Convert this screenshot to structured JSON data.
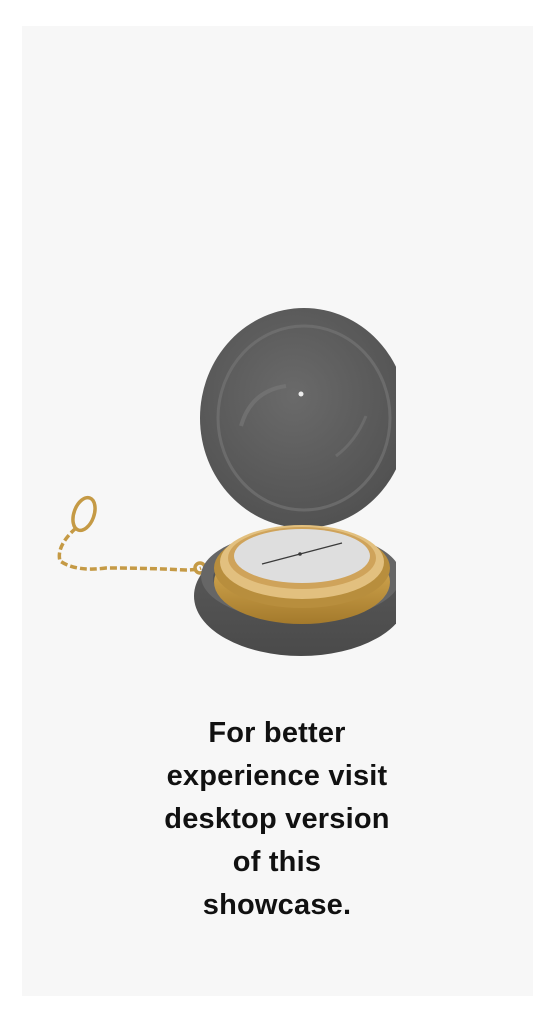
{
  "notice": {
    "lines": [
      "For better",
      "experience visit",
      "desktop version",
      "of this",
      "showcase."
    ]
  },
  "illustration": {
    "icon": "pocket-watch-icon",
    "colors": {
      "case": "#5a5a5a",
      "gold": "#c9a14a",
      "dial": "#dcdcdc",
      "background": "#f7f7f7"
    }
  }
}
